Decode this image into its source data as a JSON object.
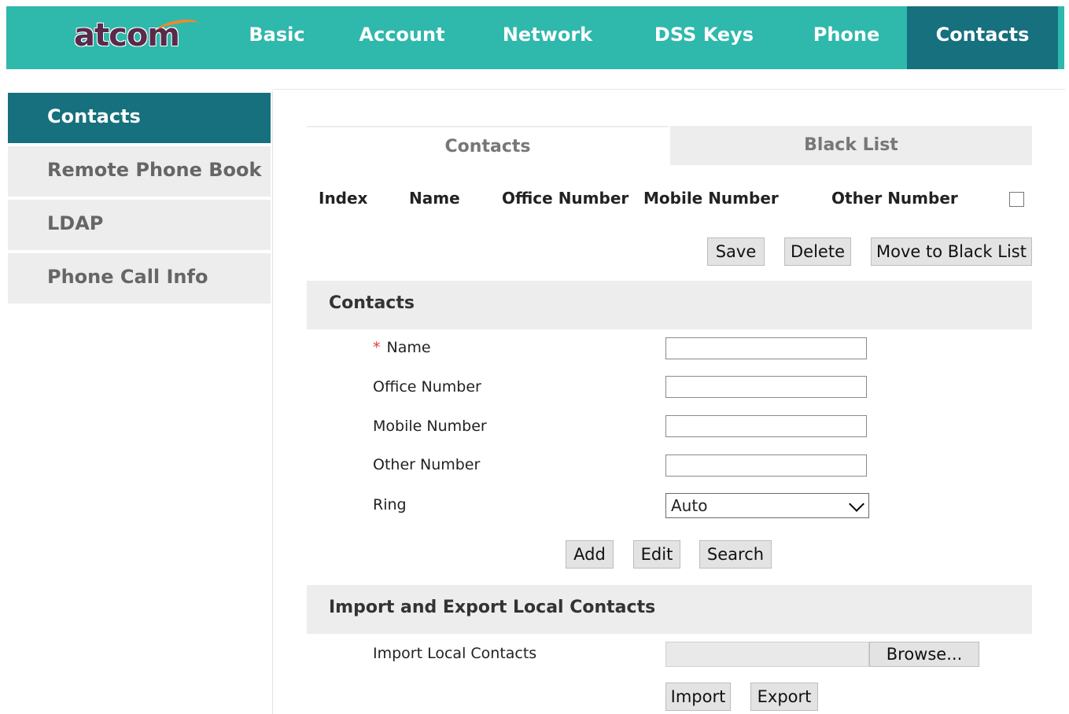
{
  "logo": {
    "text": "atcom"
  },
  "nav": [
    {
      "label": "Basic"
    },
    {
      "label": "Account"
    },
    {
      "label": "Network"
    },
    {
      "label": "DSS Keys"
    },
    {
      "label": "Phone"
    },
    {
      "label": "Contacts"
    }
  ],
  "sidebar": {
    "items": [
      {
        "label": "Contacts"
      },
      {
        "label": "Remote Phone Book"
      },
      {
        "label": "LDAP"
      },
      {
        "label": "Phone Call Info"
      }
    ]
  },
  "tabs": [
    {
      "label": "Contacts"
    },
    {
      "label": "Black List"
    }
  ],
  "table": {
    "columns": [
      "Index",
      "Name",
      "Office Number",
      "Mobile Number",
      "Other Number"
    ]
  },
  "list_actions": {
    "save": "Save",
    "delete": "Delete",
    "move": "Move to Black List"
  },
  "contacts_section": {
    "title": "Contacts",
    "required_mark": "*",
    "name_label": "Name",
    "office_label": "Office Number",
    "mobile_label": "Mobile Number",
    "other_label": "Other Number",
    "ring_label": "Ring",
    "ring_value": "Auto",
    "name_value": "",
    "office_value": "",
    "mobile_value": "",
    "other_value": "",
    "add": "Add",
    "edit": "Edit",
    "search": "Search"
  },
  "import_section": {
    "title": "Import and Export Local Contacts",
    "import_label": "Import Local Contacts",
    "browse": "Browse...",
    "import": "Import",
    "export": "Export"
  },
  "colors": {
    "nav_bg": "#2fb8ac",
    "nav_active": "#16707e",
    "logo_text": "#5a2a4a",
    "logo_accent": "#f08a2a",
    "panel_gray": "#ededed"
  }
}
